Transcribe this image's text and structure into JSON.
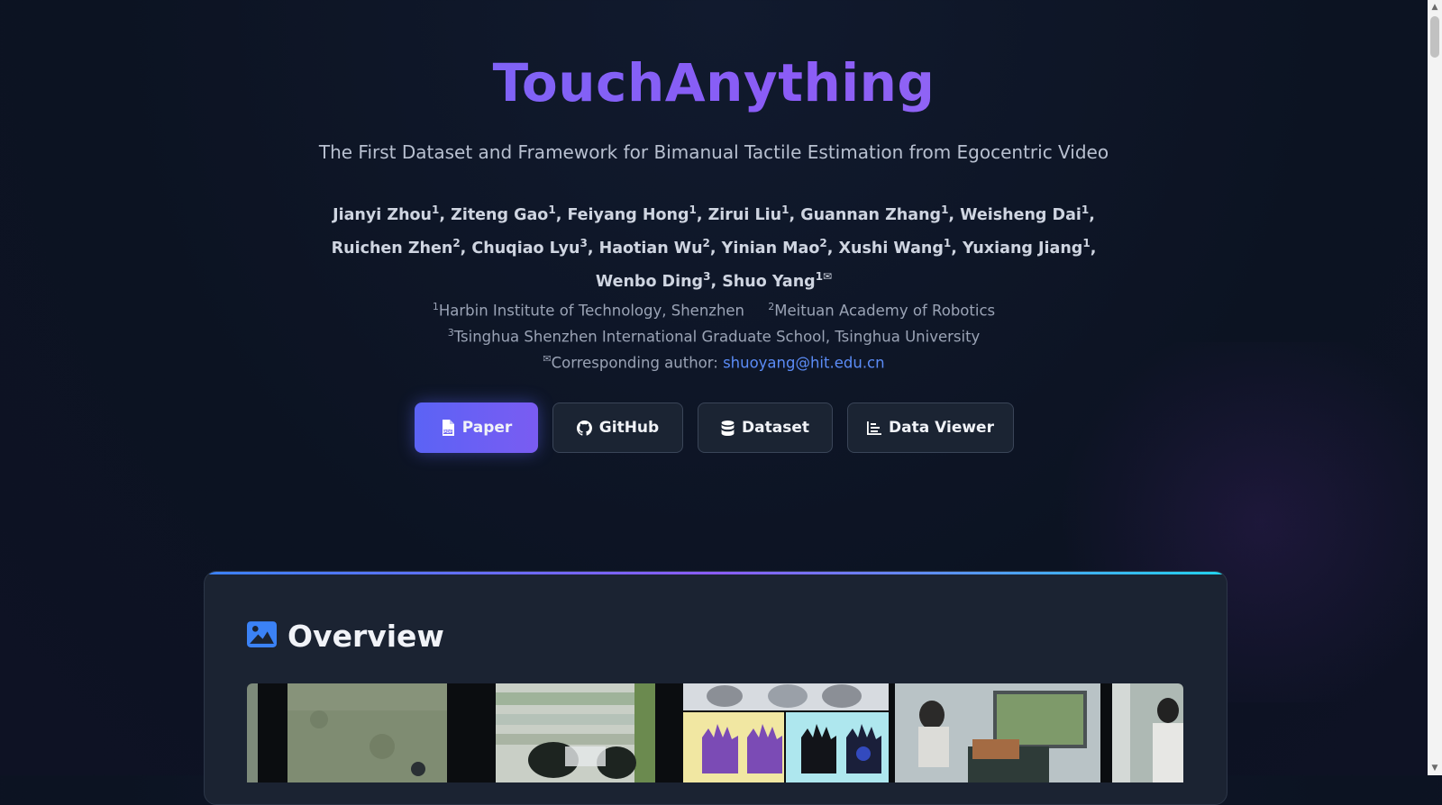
{
  "header": {
    "title": "TouchAnything",
    "subtitle": "The First Dataset and Framework for Bimanual Tactile Estimation from Egocentric Video"
  },
  "authors": [
    {
      "name": "Jianyi Zhou",
      "sup": "1"
    },
    {
      "name": "Ziteng Gao",
      "sup": "1"
    },
    {
      "name": "Feiyang Hong",
      "sup": "1"
    },
    {
      "name": "Zirui Liu",
      "sup": "1"
    },
    {
      "name": "Guannan Zhang",
      "sup": "1"
    },
    {
      "name": "Weisheng Dai",
      "sup": "1"
    },
    {
      "name": "Ruichen Zhen",
      "sup": "2"
    },
    {
      "name": "Chuqiao Lyu",
      "sup": "3"
    },
    {
      "name": "Haotian Wu",
      "sup": "2"
    },
    {
      "name": "Yinian Mao",
      "sup": "2"
    },
    {
      "name": "Xushi Wang",
      "sup": "1"
    },
    {
      "name": "Yuxiang Jiang",
      "sup": "1"
    },
    {
      "name": "Wenbo Ding",
      "sup": "3"
    },
    {
      "name": "Shuo Yang",
      "sup": "1✉"
    }
  ],
  "affiliations": {
    "a1_sup": "1",
    "a1": "Harbin Institute of Technology, Shenzhen",
    "a2_sup": "2",
    "a2": "Meituan Academy of Robotics",
    "a3_sup": "3",
    "a3": "Tsinghua Shenzhen International Graduate School, Tsinghua University",
    "corr_sup": "✉",
    "corr_label": "Corresponding author: ",
    "corr_email": "shuoyang@hit.edu.cn"
  },
  "buttons": {
    "paper": "Paper",
    "github": "GitHub",
    "dataset": "Dataset",
    "data_viewer": "Data Viewer"
  },
  "overview": {
    "title": "Overview"
  },
  "colors": {
    "accent": "#5b63f5",
    "link": "#5b8cf7",
    "card": "#1b2332"
  }
}
